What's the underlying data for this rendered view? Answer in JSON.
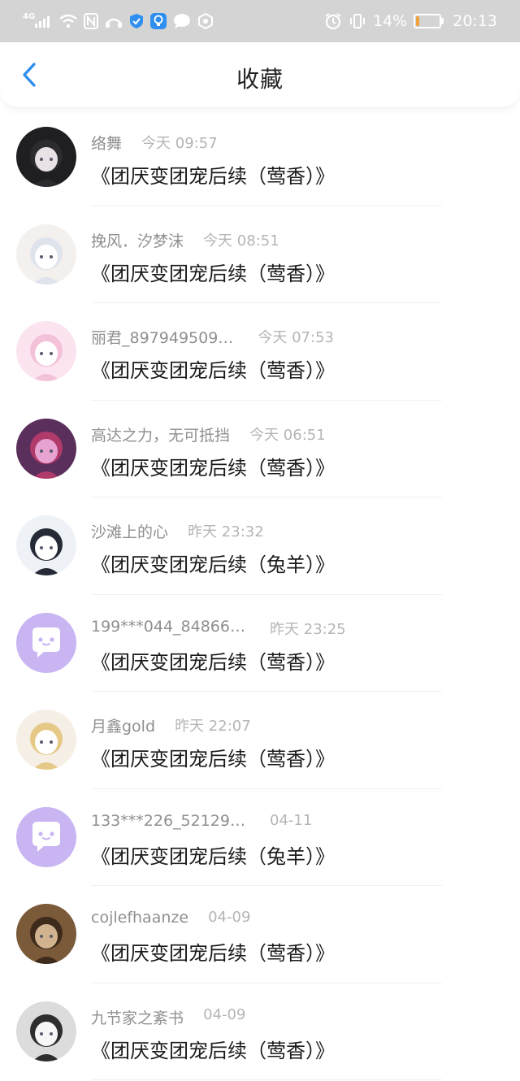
{
  "status_bar": {
    "network": "4G",
    "battery_percent": "14%",
    "battery_level": 0.14,
    "time": "20:13",
    "icons": [
      "signal-icon",
      "wifi-icon",
      "nfc-icon",
      "shield-icon",
      "bulb-icon",
      "chat-bubble-icon",
      "hexagon-icon",
      "alarm-icon",
      "vibrate-icon",
      "battery-icon"
    ]
  },
  "header": {
    "back_icon": "chevron-left-icon",
    "title": "收藏"
  },
  "items": [
    {
      "user": "络舞",
      "time": "今天 09:57",
      "title": "《团厌变团宠后续（莺香）》"
    },
    {
      "user": "挽风．汐梦沫",
      "time": "今天 08:51",
      "title": "《团厌变团宠后续（莺香）》"
    },
    {
      "user": "丽君_897949509…",
      "time": "今天 07:53",
      "title": "《团厌变团宠后续（莺香）》"
    },
    {
      "user": "高达之力，无可抵挡",
      "time": "今天 06:51",
      "title": "《团厌变团宠后续（莺香）》"
    },
    {
      "user": "沙滩上的心",
      "time": "昨天 23:32",
      "title": "《团厌变团宠后续（兔羊）》"
    },
    {
      "user": "199***044_84866…",
      "time": "昨天 23:25",
      "title": "《团厌变团宠后续（莺香）》"
    },
    {
      "user": "月鑫gold",
      "time": "昨天 22:07",
      "title": "《团厌变团宠后续（莺香）》"
    },
    {
      "user": "133***226_52129…",
      "time": "04-11",
      "title": "《团厌变团宠后续（兔羊）》"
    },
    {
      "user": "cojlefhaanze",
      "time": "04-09",
      "title": "《团厌变团宠后续（莺香）》"
    },
    {
      "user": "九节家之紊书",
      "time": "04-09",
      "title": "《团厌变团宠后续（莺香）》"
    }
  ],
  "colors": {
    "status_bar_bg": "#d4d4d4",
    "accent_blue": "#2f8ff0",
    "default_avatar_bg": "#c9b5f2",
    "title_text": "#1a1a1a",
    "meta_text": "#8f8f8f"
  }
}
